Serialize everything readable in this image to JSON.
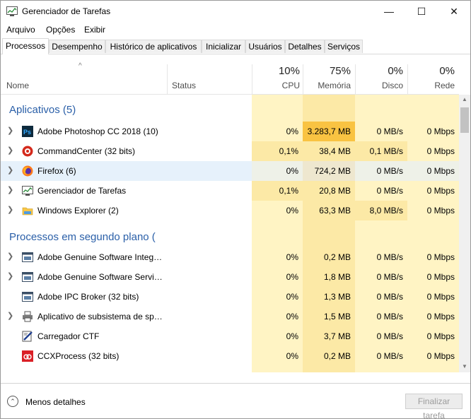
{
  "window": {
    "title": "Gerenciador de Tarefas",
    "controls": {
      "minimize": "—",
      "maximize": "☐",
      "close": "✕"
    }
  },
  "menu": [
    "Arquivo",
    "Opções",
    "Exibir"
  ],
  "tabs": [
    {
      "label": "Processos",
      "active": true
    },
    {
      "label": "Desempenho"
    },
    {
      "label": "Histórico de aplicativos"
    },
    {
      "label": "Inicializar"
    },
    {
      "label": "Usuários"
    },
    {
      "label": "Detalhes"
    },
    {
      "label": "Serviços"
    }
  ],
  "columns": {
    "sort_arrow": "^",
    "name": "Nome",
    "status": "Status",
    "cpu": {
      "pct": "10%",
      "label": "CPU"
    },
    "memory": {
      "pct": "75%",
      "label": "Memória"
    },
    "disk": {
      "pct": "0%",
      "label": "Disco"
    },
    "network": {
      "pct": "0%",
      "label": "Rede"
    }
  },
  "groups": {
    "apps": {
      "title": "Aplicativos (5)",
      "rows": [
        {
          "name": "Adobe Photoshop CC 2018 (10)",
          "icon": "photoshop-icon",
          "cpu": "0%",
          "mem": "3.283,7 MB",
          "disk": "0 MB/s",
          "net": "0 Mbps",
          "mem_level": "high"
        },
        {
          "name": "CommandCenter (32 bits)",
          "icon": "commandcenter-icon",
          "cpu": "0,1%",
          "mem": "38,4 MB",
          "disk": "0,1 MB/s",
          "net": "0 Mbps"
        },
        {
          "name": "Firefox (6)",
          "icon": "firefox-icon",
          "cpu": "0%",
          "mem": "724,2 MB",
          "disk": "0 MB/s",
          "net": "0 Mbps",
          "highlighted": true
        },
        {
          "name": "Gerenciador de Tarefas",
          "icon": "task-manager-icon",
          "cpu": "0,1%",
          "mem": "20,8 MB",
          "disk": "0 MB/s",
          "net": "0 Mbps"
        },
        {
          "name": "Windows Explorer (2)",
          "icon": "folder-icon",
          "cpu": "0%",
          "mem": "63,3 MB",
          "disk": "8,0 MB/s",
          "net": "0 Mbps"
        }
      ]
    },
    "background": {
      "title": "Processos em segundo plano (",
      "rows": [
        {
          "name": "Adobe Genuine Software Integri...",
          "icon": "app-window-icon",
          "cpu": "0%",
          "mem": "0,2 MB",
          "disk": "0 MB/s",
          "net": "0 Mbps",
          "expandable": true
        },
        {
          "name": "Adobe Genuine Software Servic...",
          "icon": "app-window-icon",
          "cpu": "0%",
          "mem": "1,8 MB",
          "disk": "0 MB/s",
          "net": "0 Mbps",
          "expandable": true
        },
        {
          "name": "Adobe IPC Broker (32 bits)",
          "icon": "app-window-icon",
          "cpu": "0%",
          "mem": "1,3 MB",
          "disk": "0 MB/s",
          "net": "0 Mbps",
          "expandable": false
        },
        {
          "name": "Aplicativo de subsistema de spo...",
          "icon": "printer-icon",
          "cpu": "0%",
          "mem": "1,5 MB",
          "disk": "0 MB/s",
          "net": "0 Mbps",
          "expandable": true
        },
        {
          "name": "Carregador CTF",
          "icon": "ctf-loader-icon",
          "cpu": "0%",
          "mem": "3,7 MB",
          "disk": "0 MB/s",
          "net": "0 Mbps",
          "expandable": false
        },
        {
          "name": "CCXProcess (32 bits)",
          "icon": "creative-cloud-icon",
          "cpu": "0%",
          "mem": "0,2 MB",
          "disk": "0 MB/s",
          "net": "0 Mbps",
          "expandable": false
        }
      ]
    }
  },
  "footer": {
    "less_details": "Menos detalhes",
    "end_task": "Finalizar tarefa"
  },
  "colors": {
    "heat_light": "#fff4c4",
    "heat_medium": "#fce9a6",
    "heat_high": "#f9c342",
    "group_title": "#2a5fa8",
    "selection": "#e6f1fb"
  }
}
